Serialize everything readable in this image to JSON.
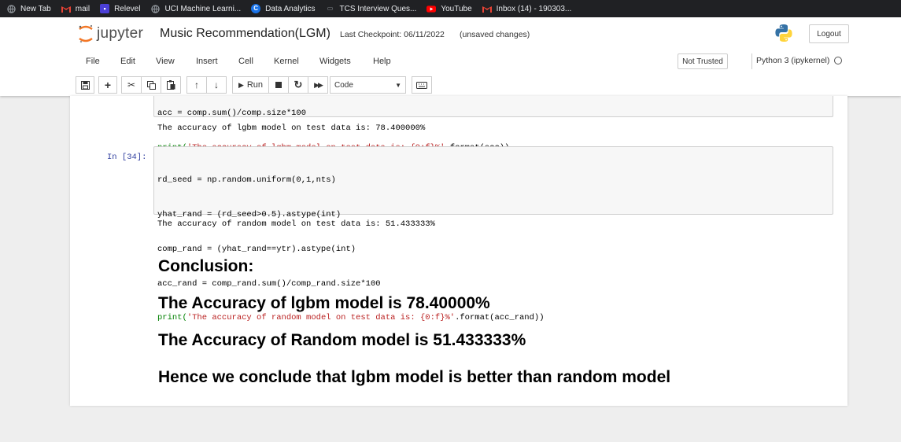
{
  "bookmarks": [
    {
      "label": "New Tab",
      "icon": "globe-icon",
      "color": "#9aa0a6"
    },
    {
      "label": "mail",
      "icon": "gmail-icon",
      "color": "#ea4335"
    },
    {
      "label": "Relevel",
      "icon": "relevel-icon",
      "color": "#4b3fd6"
    },
    {
      "label": "UCI Machine Learni...",
      "icon": "globe-icon",
      "color": "#9aa0a6"
    },
    {
      "label": "Data Analytics",
      "icon": "data-analytics-icon",
      "color": "#1a73e8"
    },
    {
      "label": "TCS Interview Ques...",
      "icon": "tcs-icon",
      "color": "#9aa0a6"
    },
    {
      "label": "YouTube",
      "icon": "youtube-icon",
      "color": "#ff0000"
    },
    {
      "label": "Inbox (14) - 190303...",
      "icon": "gmail-icon",
      "color": "#ea4335"
    }
  ],
  "header": {
    "logo_text": "jupyter",
    "title": "Music Recommendation(LGM)",
    "checkpoint": "Last Checkpoint: 06/11/2022",
    "unsaved": "(unsaved changes)",
    "logout": "Logout"
  },
  "menu": {
    "file": "File",
    "edit": "Edit",
    "view": "View",
    "insert": "Insert",
    "cell": "Cell",
    "kernel": "Kernel",
    "widgets": "Widgets",
    "help": "Help"
  },
  "status": {
    "trust": "Not Trusted",
    "kernel": "Python 3 (ipykernel)"
  },
  "toolbar": {
    "run_label": "Run",
    "cell_type": "Code"
  },
  "cells": {
    "cell1": {
      "partial_line": "acc = comp.sum()/comp.size*100",
      "print_line_pre": "print(",
      "print_line_str": "'The accuracy of lgbm model on test data is: {0:f}%'",
      "print_line_post": ".format(acc))",
      "output": "The accuracy of lgbm model on test data is: 78.400000%"
    },
    "cell2": {
      "prompt": "In [34]:",
      "line1": "rd_seed = np.random.uniform(0,1,nts)",
      "line2": "yhat_rand = (rd_seed>0.5).astype(int)",
      "line3": "comp_rand = (yhat_rand==ytr).astype(int)",
      "line4": "acc_rand = comp_rand.sum()/comp_rand.size*100",
      "print_pre": "print(",
      "print_str": "'The accuracy of random model on test data is: {0:f}%'",
      "print_post": ".format(acc_rand))",
      "output": "The accuracy of random model on test data is: 51.433333%"
    }
  },
  "markdown": {
    "heading": "Conclusion:",
    "line1": "The Accuracy of lgbm model is 78.40000%",
    "line2": "The Accuracy of Random model is 51.433333%",
    "line3": "Hence we conclude that lgbm model is better than random model"
  }
}
